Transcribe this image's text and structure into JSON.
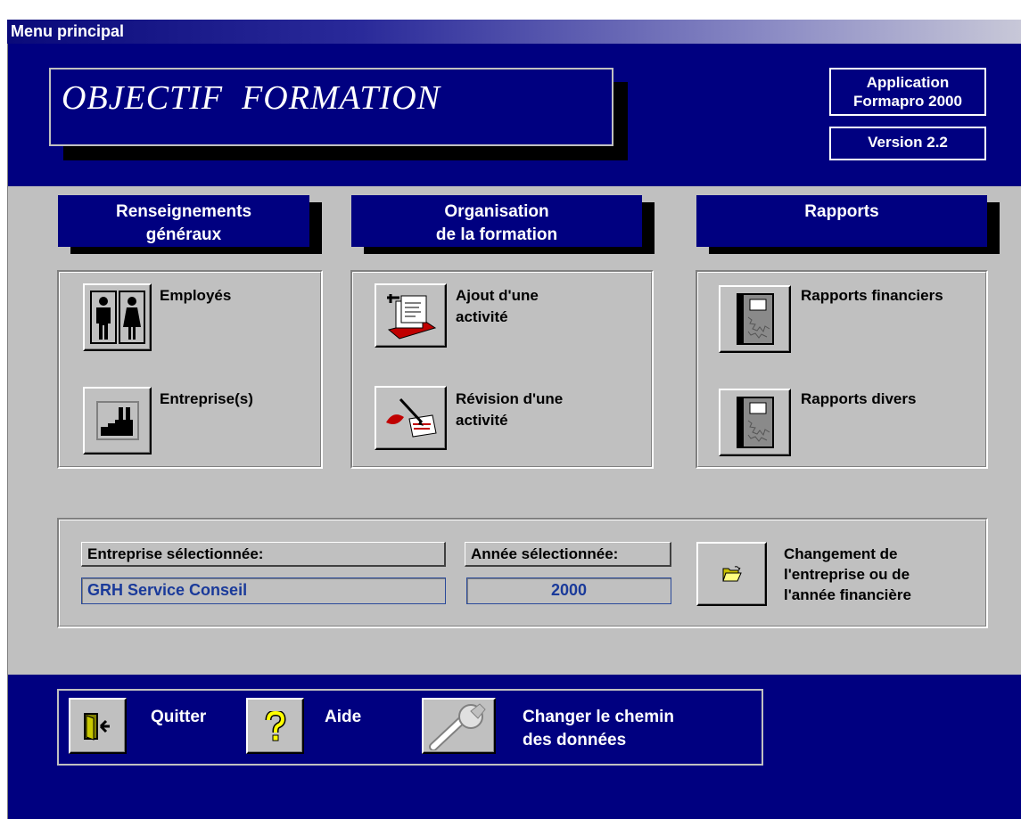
{
  "window": {
    "title": "Menu principal"
  },
  "header": {
    "banner_title": "OBJECTIF  FORMATION",
    "app_name": "Application\nFormapro 2000",
    "version": "Version 2.2"
  },
  "sections": {
    "general": {
      "title": "Renseignements\ngénéraux",
      "items": [
        {
          "label": "Employés",
          "icon": "employees-icon"
        },
        {
          "label": "Entreprise(s)",
          "icon": "factory-icon"
        }
      ]
    },
    "training": {
      "title": "Organisation\nde la formation",
      "items": [
        {
          "label": "Ajout d'une\nactivité",
          "icon": "add-activity-icon"
        },
        {
          "label": "Révision d'une\nactivité",
          "icon": "revise-activity-icon"
        }
      ]
    },
    "reports": {
      "title": "Rapports",
      "items": [
        {
          "label": "Rapports financiers",
          "icon": "report-notebook-icon"
        },
        {
          "label": "Rapports divers",
          "icon": "report-notebook-icon"
        }
      ]
    }
  },
  "selection": {
    "company_label": "Entreprise sélectionnée:",
    "company_value": "GRH Service Conseil",
    "year_label": "Année sélectionnée:",
    "year_value": "2000",
    "change_label": "Changement de\nl'entreprise ou de\nl'année financière",
    "change_icon": "open-folder-icon"
  },
  "footer": {
    "quit_label": "Quitter",
    "help_label": "Aide",
    "path_label": "Changer le chemin\ndes données",
    "quit_icon": "exit-door-icon",
    "help_icon": "question-mark-icon",
    "path_icon": "wrench-icon"
  },
  "colors": {
    "navy": "#000080",
    "dialog_gray": "#c0c0c0",
    "field_text": "#1a3a9a"
  }
}
